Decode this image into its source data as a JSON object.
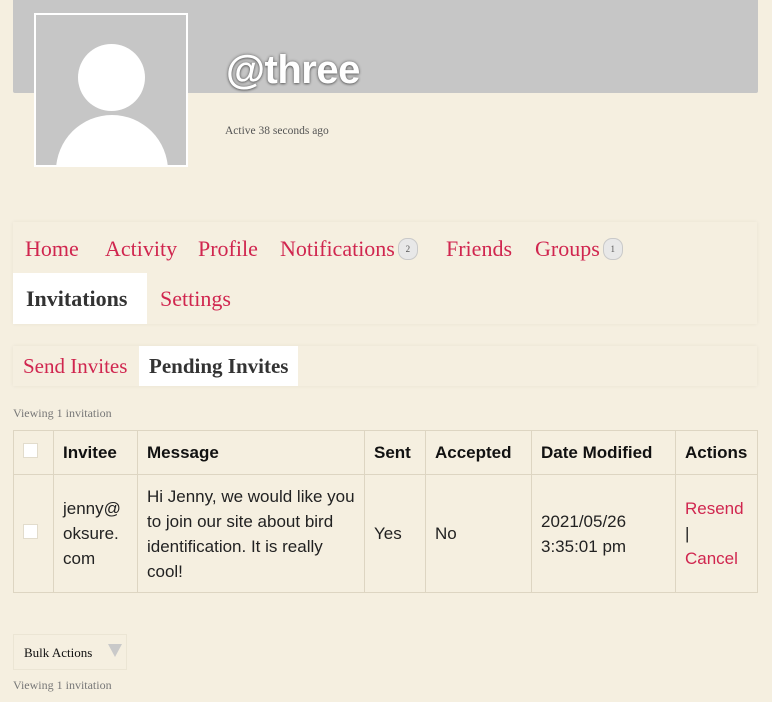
{
  "profile": {
    "username": "@three",
    "last_active": "Active 38 seconds ago",
    "avatar_icon": "default-user-avatar"
  },
  "nav": {
    "items": [
      {
        "label": "Home"
      },
      {
        "label": "Activity"
      },
      {
        "label": "Profile"
      },
      {
        "label": "Notifications",
        "count": "2"
      },
      {
        "label": "Friends"
      },
      {
        "label": "Groups",
        "count": "1"
      },
      {
        "label": "Invitations",
        "current": true
      },
      {
        "label": "Settings"
      }
    ]
  },
  "subnav": {
    "items": [
      {
        "label": "Send Invites"
      },
      {
        "label": "Pending Invites",
        "current": true
      }
    ]
  },
  "pagination": {
    "top": "Viewing 1 invitation",
    "bottom": "Viewing 1 invitation"
  },
  "table": {
    "headers": [
      "Invitee",
      "Message",
      "Sent",
      "Accepted",
      "Date Modified",
      "Actions"
    ],
    "rows": [
      {
        "invitee": "jenny@oksure.com",
        "invitee_lines": [
          "jenny@",
          "oksure.",
          "com"
        ],
        "message": "Hi Jenny, we would like you to join our site about bird identification. It is really cool!",
        "sent": "Yes",
        "accepted": "No",
        "date_modified": "2021/05/26 3:35:01 pm",
        "date_line1": "2021/05/26",
        "date_line2": "3:35:01 pm",
        "actions": {
          "resend": "Resend",
          "separator": "|",
          "cancel": "Cancel"
        }
      }
    ]
  },
  "bulk_actions": {
    "label": "Bulk Actions"
  },
  "colors": {
    "background": "#f5efe0",
    "accent": "#d0264f",
    "cover": "#c6c6c6"
  }
}
